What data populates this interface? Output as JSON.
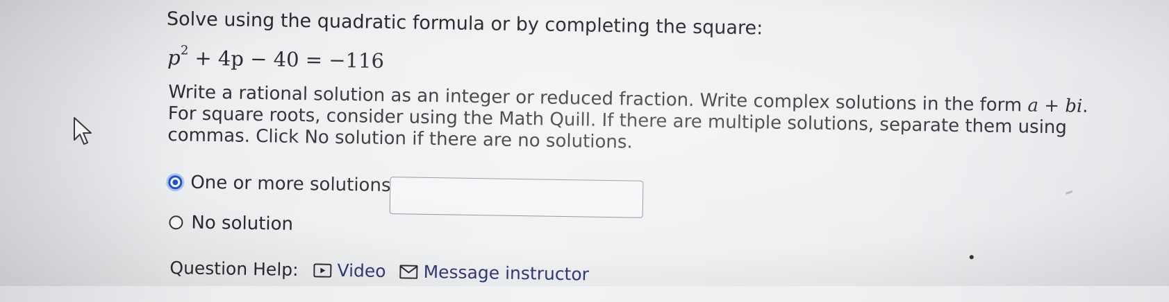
{
  "question": {
    "instruction": "Solve using the quadratic formula or by completing the square:",
    "equation": {
      "variable": "p",
      "exponent": "2",
      "rest": "+ 4p − 40 = −116"
    },
    "directions": {
      "part1": "Write a rational solution as an integer or reduced fraction. Write complex solutions in the form ",
      "math_form": "a + bi",
      "part2": ". For square roots, consider using the Math Quill. If there are multiple solutions, separate them using commas. Click No solution if there are no solutions."
    }
  },
  "answer_options": {
    "one_or_more_label": "One or more solutions:",
    "no_solution_label": "No solution",
    "selected": "one_or_more",
    "input_value": ""
  },
  "question_help": {
    "label": "Question Help:",
    "video_label": "Video",
    "message_label": "Message instructor"
  },
  "colors": {
    "radio_selected": "#1a56c9",
    "link": "#2f3a7a"
  },
  "icons": {
    "cursor": "mouse-pointer-icon",
    "video": "video-play-icon",
    "message": "envelope-icon"
  }
}
